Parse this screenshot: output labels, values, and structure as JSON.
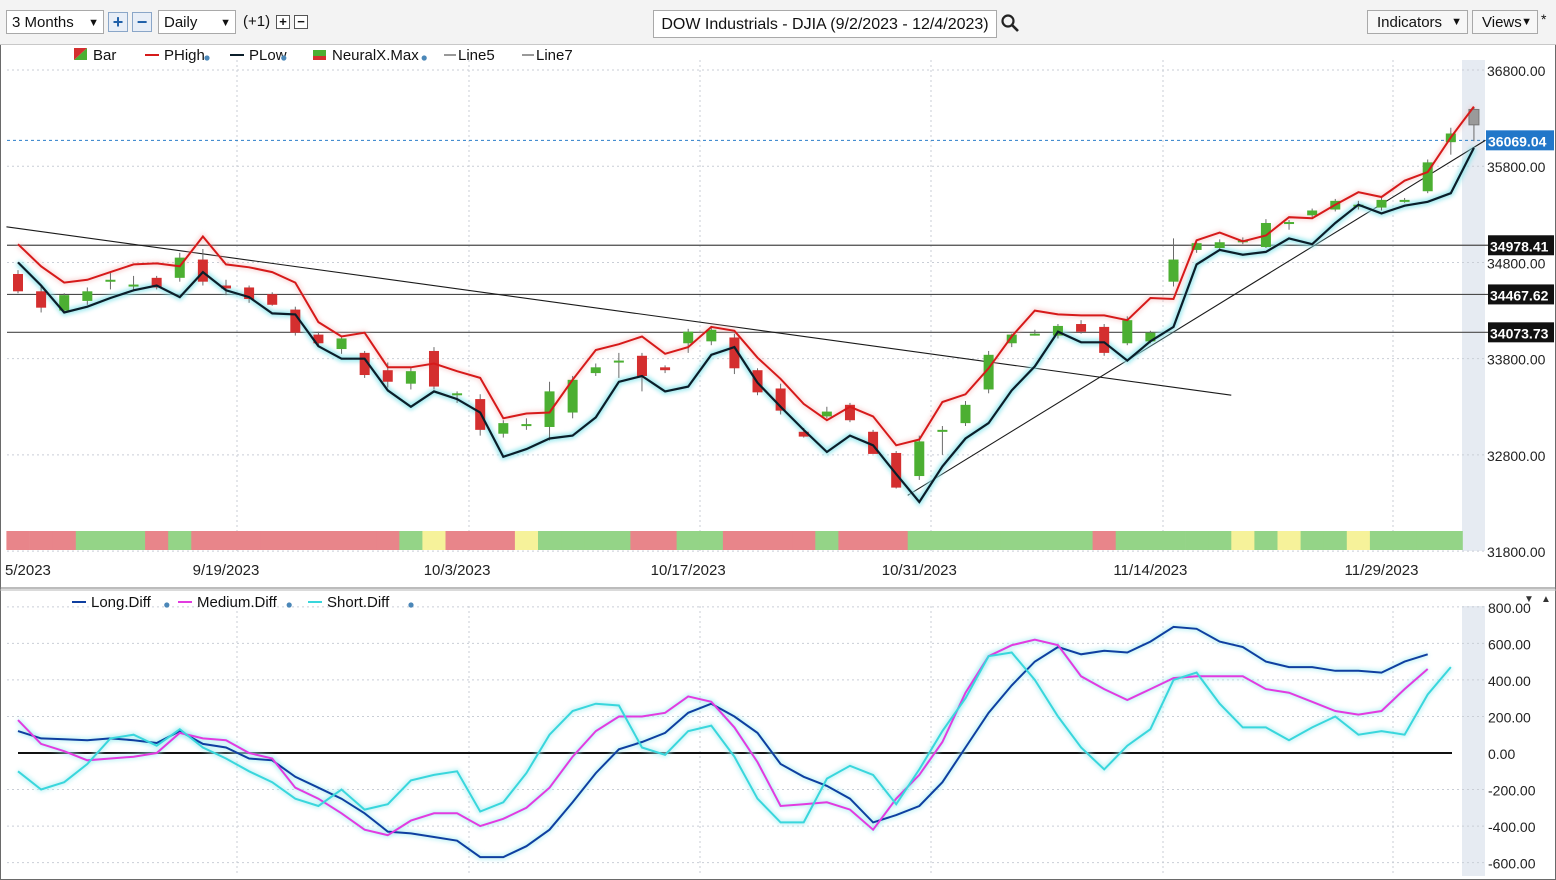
{
  "toolbar": {
    "period": "3 Months",
    "interval": "Daily",
    "offset": "(+1)",
    "title": "DOW Industrials - DJIA (9/2/2023 - 12/4/2023)",
    "indicators": "Indicators",
    "views": "Views",
    "views_suffix": "*"
  },
  "price_legend": [
    "Bar",
    "PHigh",
    "PLow",
    "NeuralX.Max",
    "Line5",
    "Line7"
  ],
  "osc_legend": [
    "Long.Diff",
    "Medium.Diff",
    "Short.Diff"
  ],
  "colors": {
    "up": "#4caf32",
    "down": "#d42f2f",
    "phigh": "#d61a1a",
    "plow": "#0b1e2a",
    "long": "#0f3fa0",
    "medium": "#e23be0",
    "short": "#39d6dc",
    "band_red": "#e8858a",
    "band_green": "#94d487",
    "band_yellow": "#f6f29a",
    "price_tag": "#2277c9"
  },
  "chart_data": [
    {
      "type": "candlestick",
      "title": "DOW Industrials - DJIA (9/2/2023 - 12/4/2023)",
      "ylim": [
        31800,
        37000
      ],
      "y_ticks": [
        31800,
        32800,
        33800,
        34800,
        35800,
        36800
      ],
      "y_tick_labels": [
        "31800.00",
        "32800.00",
        "33800.00",
        "34800.00",
        "35800.00",
        "36800.00"
      ],
      "x_tick_labels": [
        {
          "i": -1,
          "label": "5/2023"
        },
        {
          "i": 9,
          "label": "9/19/2023"
        },
        {
          "i": 19,
          "label": "10/3/2023"
        },
        {
          "i": 29,
          "label": "10/17/2023"
        },
        {
          "i": 39,
          "label": "10/31/2023"
        },
        {
          "i": 49,
          "label": "11/14/2023"
        },
        {
          "i": 59,
          "label": "11/29/2023"
        }
      ],
      "bars": [
        {
          "o": 34680,
          "h": 34720,
          "l": 34480,
          "c": 34500,
          "ph": 34990,
          "pl": 34800
        },
        {
          "o": 34500,
          "h": 34560,
          "l": 34280,
          "c": 34330,
          "ph": 34760,
          "pl": 34560
        },
        {
          "o": 34300,
          "h": 34480,
          "l": 34280,
          "c": 34460,
          "ph": 34590,
          "pl": 34280
        },
        {
          "o": 34400,
          "h": 34540,
          "l": 34360,
          "c": 34500,
          "ph": 34620,
          "pl": 34340
        },
        {
          "o": 34600,
          "h": 34690,
          "l": 34520,
          "c": 34620,
          "ph": 34700,
          "pl": 34430
        },
        {
          "o": 34560,
          "h": 34660,
          "l": 34500,
          "c": 34570,
          "ph": 34780,
          "pl": 34510
        },
        {
          "o": 34640,
          "h": 34660,
          "l": 34520,
          "c": 34540,
          "ph": 34790,
          "pl": 34560
        },
        {
          "o": 34640,
          "h": 34900,
          "l": 34600,
          "c": 34850,
          "ph": 34760,
          "pl": 34440
        },
        {
          "o": 34830,
          "h": 34940,
          "l": 34560,
          "c": 34600,
          "ph": 35070,
          "pl": 34700
        },
        {
          "o": 34560,
          "h": 34620,
          "l": 34460,
          "c": 34530,
          "ph": 34780,
          "pl": 34510
        },
        {
          "o": 34540,
          "h": 34560,
          "l": 34380,
          "c": 34420,
          "ph": 34750,
          "pl": 34440
        },
        {
          "o": 34470,
          "h": 34490,
          "l": 34350,
          "c": 34360,
          "ph": 34700,
          "pl": 34270
        },
        {
          "o": 34310,
          "h": 34340,
          "l": 34040,
          "c": 34070,
          "ph": 34590,
          "pl": 34260
        },
        {
          "o": 34050,
          "h": 34080,
          "l": 33930,
          "c": 33960,
          "ph": 34180,
          "pl": 33930
        },
        {
          "o": 33900,
          "h": 34020,
          "l": 33850,
          "c": 34010,
          "ph": 34030,
          "pl": 33800
        },
        {
          "o": 33860,
          "h": 33880,
          "l": 33600,
          "c": 33630,
          "ph": 34070,
          "pl": 33800
        },
        {
          "o": 33680,
          "h": 33760,
          "l": 33500,
          "c": 33560,
          "ph": 33710,
          "pl": 33470
        },
        {
          "o": 33540,
          "h": 33710,
          "l": 33480,
          "c": 33670,
          "ph": 33710,
          "pl": 33300
        },
        {
          "o": 33880,
          "h": 33920,
          "l": 33480,
          "c": 33510,
          "ph": 33750,
          "pl": 33460
        },
        {
          "o": 33440,
          "h": 33460,
          "l": 33340,
          "c": 33440,
          "ph": 33670,
          "pl": 33380
        },
        {
          "o": 33380,
          "h": 33430,
          "l": 33000,
          "c": 33060,
          "ph": 33600,
          "pl": 33240
        },
        {
          "o": 33020,
          "h": 33160,
          "l": 32980,
          "c": 33130,
          "ph": 33180,
          "pl": 32780
        },
        {
          "o": 33120,
          "h": 33180,
          "l": 33060,
          "c": 33120,
          "ph": 33230,
          "pl": 32860
        },
        {
          "o": 33090,
          "h": 33560,
          "l": 32950,
          "c": 33460,
          "ph": 33240,
          "pl": 32970
        },
        {
          "o": 33240,
          "h": 33620,
          "l": 33180,
          "c": 33580,
          "ph": 33580,
          "pl": 33000
        },
        {
          "o": 33650,
          "h": 33750,
          "l": 33620,
          "c": 33710,
          "ph": 33890,
          "pl": 33190
        },
        {
          "o": 33770,
          "h": 33860,
          "l": 33600,
          "c": 33780,
          "ph": 33950,
          "pl": 33560
        },
        {
          "o": 33830,
          "h": 33860,
          "l": 33460,
          "c": 33620,
          "ph": 34030,
          "pl": 33620
        },
        {
          "o": 33710,
          "h": 33730,
          "l": 33650,
          "c": 33680,
          "ph": 33850,
          "pl": 33460
        },
        {
          "o": 33960,
          "h": 34110,
          "l": 33860,
          "c": 34080,
          "ph": 33920,
          "pl": 33510
        },
        {
          "o": 33980,
          "h": 34140,
          "l": 33940,
          "c": 34100,
          "ph": 34130,
          "pl": 33840
        },
        {
          "o": 34020,
          "h": 34060,
          "l": 33640,
          "c": 33700,
          "ph": 34090,
          "pl": 33920
        },
        {
          "o": 33680,
          "h": 33700,
          "l": 33420,
          "c": 33450,
          "ph": 33810,
          "pl": 33550
        },
        {
          "o": 33490,
          "h": 33540,
          "l": 33220,
          "c": 33260,
          "ph": 33590,
          "pl": 33300
        },
        {
          "o": 33040,
          "h": 33080,
          "l": 32980,
          "c": 32990,
          "ph": 33330,
          "pl": 33060
        },
        {
          "o": 33200,
          "h": 33300,
          "l": 33180,
          "c": 33250,
          "ph": 33160,
          "pl": 32830
        },
        {
          "o": 33320,
          "h": 33340,
          "l": 33140,
          "c": 33160,
          "ph": 33300,
          "pl": 33000
        },
        {
          "o": 33040,
          "h": 33060,
          "l": 32860,
          "c": 32810,
          "ph": 33200,
          "pl": 32900
        },
        {
          "o": 32820,
          "h": 32840,
          "l": 32450,
          "c": 32460,
          "ph": 32900,
          "pl": 32600
        },
        {
          "o": 32580,
          "h": 33000,
          "l": 32540,
          "c": 32940,
          "ph": 32960,
          "pl": 32310
        },
        {
          "o": 33040,
          "h": 33100,
          "l": 32800,
          "c": 33060,
          "ph": 33350,
          "pl": 32680
        },
        {
          "o": 33130,
          "h": 33360,
          "l": 33100,
          "c": 33320,
          "ph": 33430,
          "pl": 32970
        },
        {
          "o": 33480,
          "h": 33880,
          "l": 33440,
          "c": 33840,
          "ph": 33700,
          "pl": 33130
        },
        {
          "o": 33960,
          "h": 34060,
          "l": 33920,
          "c": 34050,
          "ph": 34030,
          "pl": 33470
        },
        {
          "o": 34060,
          "h": 34100,
          "l": 34040,
          "c": 34060,
          "ph": 34300,
          "pl": 33720
        },
        {
          "o": 34040,
          "h": 34160,
          "l": 34010,
          "c": 34140,
          "ph": 34260,
          "pl": 34080
        },
        {
          "o": 34160,
          "h": 34200,
          "l": 34060,
          "c": 34080,
          "ph": 34250,
          "pl": 33970
        },
        {
          "o": 34130,
          "h": 34160,
          "l": 33830,
          "c": 33860,
          "ph": 34250,
          "pl": 33970
        },
        {
          "o": 33960,
          "h": 34240,
          "l": 33940,
          "c": 34200,
          "ph": 34200,
          "pl": 33780
        },
        {
          "o": 33980,
          "h": 34090,
          "l": 33960,
          "c": 34070,
          "ph": 34430,
          "pl": 33980
        },
        {
          "o": 34600,
          "h": 35050,
          "l": 34550,
          "c": 34830,
          "ph": 34420,
          "pl": 34130
        },
        {
          "o": 34930,
          "h": 35010,
          "l": 34900,
          "c": 35000,
          "ph": 35030,
          "pl": 34780
        },
        {
          "o": 34950,
          "h": 35040,
          "l": 34920,
          "c": 35010,
          "ph": 35110,
          "pl": 34930
        },
        {
          "o": 35010,
          "h": 35060,
          "l": 34990,
          "c": 35030,
          "ph": 35020,
          "pl": 34880
        },
        {
          "o": 34960,
          "h": 35250,
          "l": 34950,
          "c": 35210,
          "ph": 35080,
          "pl": 34910
        },
        {
          "o": 35210,
          "h": 35240,
          "l": 35140,
          "c": 35220,
          "ph": 35270,
          "pl": 35050
        },
        {
          "o": 35290,
          "h": 35360,
          "l": 35270,
          "c": 35340,
          "ph": 35260,
          "pl": 34990
        },
        {
          "o": 35350,
          "h": 35460,
          "l": 35330,
          "c": 35440,
          "ph": 35400,
          "pl": 35210
        },
        {
          "o": 35380,
          "h": 35440,
          "l": 35350,
          "c": 35400,
          "ph": 35530,
          "pl": 35400
        },
        {
          "o": 35370,
          "h": 35480,
          "l": 35340,
          "c": 35450,
          "ph": 35480,
          "pl": 35310
        },
        {
          "o": 35450,
          "h": 35470,
          "l": 35420,
          "c": 35450,
          "ph": 35650,
          "pl": 35390
        },
        {
          "o": 35540,
          "h": 35870,
          "l": 35520,
          "c": 35840,
          "ph": 35740,
          "pl": 35430
        },
        {
          "o": 36050,
          "h": 36200,
          "l": 35920,
          "c": 36140,
          "ph": 36100,
          "pl": 35520
        },
        {
          "o": 36230,
          "h": 36410,
          "l": 36060,
          "c": 36390,
          "ph": 36420,
          "pl": 35990
        }
      ],
      "horizontal_levels": [
        {
          "value": 34978.41,
          "label": "34978.41"
        },
        {
          "value": 34467.62,
          "label": "34467.62"
        },
        {
          "value": 34073.73,
          "label": "34073.73"
        }
      ],
      "last_price": {
        "value": 36069.04,
        "label": "36069.04"
      },
      "trend_lines": [
        {
          "name": "Line5",
          "from": {
            "i": -0.5,
            "v": 35170
          },
          "to": {
            "i": 52.5,
            "v": 33420
          }
        },
        {
          "name": "Line7",
          "from": {
            "i": 38.5,
            "v": 32380
          },
          "to": {
            "i": 63.5,
            "v": 36070
          }
        }
      ],
      "signal_band": [
        "red",
        "red",
        "red",
        "green",
        "green",
        "green",
        "red",
        "green",
        "red",
        "red",
        "red",
        "red",
        "red",
        "red",
        "red",
        "red",
        "red",
        "green",
        "yellow",
        "red",
        "red",
        "red",
        "yellow",
        "green",
        "green",
        "green",
        "green",
        "red",
        "red",
        "green",
        "green",
        "red",
        "red",
        "red",
        "red",
        "green",
        "red",
        "red",
        "red",
        "green",
        "green",
        "green",
        "green",
        "green",
        "green",
        "green",
        "green",
        "red",
        "green",
        "green",
        "green",
        "green",
        "green",
        "yellow",
        "green",
        "yellow",
        "green",
        "green",
        "yellow",
        "green",
        "green",
        "green",
        "green"
      ]
    },
    {
      "type": "line",
      "ylim": [
        -650,
        830
      ],
      "y_ticks": [
        -600,
        -400,
        -200,
        0,
        200,
        400,
        600,
        800
      ],
      "y_tick_labels": [
        "-600.00",
        "-400.00",
        "-200.00",
        "0.00",
        "200.00",
        "400.00",
        "600.00",
        "800.00"
      ],
      "series": [
        {
          "name": "Long.Diff",
          "values": [
            120,
            80,
            75,
            70,
            80,
            70,
            55,
            120,
            50,
            30,
            -30,
            -40,
            -130,
            -190,
            -250,
            -330,
            -430,
            -440,
            -460,
            -480,
            -570,
            -570,
            -510,
            -420,
            -270,
            -110,
            20,
            60,
            110,
            220,
            270,
            200,
            110,
            -60,
            -130,
            -180,
            -250,
            -380,
            -340,
            -290,
            -160,
            30,
            220,
            370,
            500,
            580,
            540,
            560,
            550,
            610,
            690,
            680,
            610,
            580,
            500,
            470,
            470,
            450,
            450,
            440,
            500,
            540
          ]
        },
        {
          "name": "Medium.Diff",
          "values": [
            180,
            50,
            10,
            -40,
            -30,
            -20,
            0,
            110,
            80,
            70,
            0,
            -30,
            -190,
            -250,
            -330,
            -420,
            -450,
            -370,
            -330,
            -330,
            -400,
            -360,
            -300,
            -190,
            -20,
            120,
            200,
            200,
            220,
            310,
            280,
            140,
            -50,
            -290,
            -280,
            -270,
            -310,
            -420,
            -250,
            -120,
            60,
            330,
            530,
            590,
            620,
            590,
            420,
            350,
            290,
            350,
            410,
            420,
            420,
            420,
            350,
            330,
            280,
            230,
            210,
            230,
            350,
            460
          ]
        },
        {
          "name": "Short.Diff",
          "values": [
            -100,
            -200,
            -160,
            -60,
            80,
            100,
            40,
            130,
            30,
            -30,
            -100,
            -160,
            -250,
            -290,
            -200,
            -310,
            -280,
            -150,
            -120,
            -100,
            -320,
            -270,
            -110,
            100,
            230,
            270,
            260,
            30,
            -10,
            120,
            150,
            -20,
            -250,
            -380,
            -380,
            -140,
            -70,
            -120,
            -280,
            -90,
            120,
            300,
            530,
            550,
            400,
            200,
            30,
            -90,
            40,
            130,
            400,
            440,
            270,
            140,
            140,
            70,
            140,
            200,
            100,
            120,
            100,
            320,
            470
          ]
        }
      ]
    }
  ]
}
